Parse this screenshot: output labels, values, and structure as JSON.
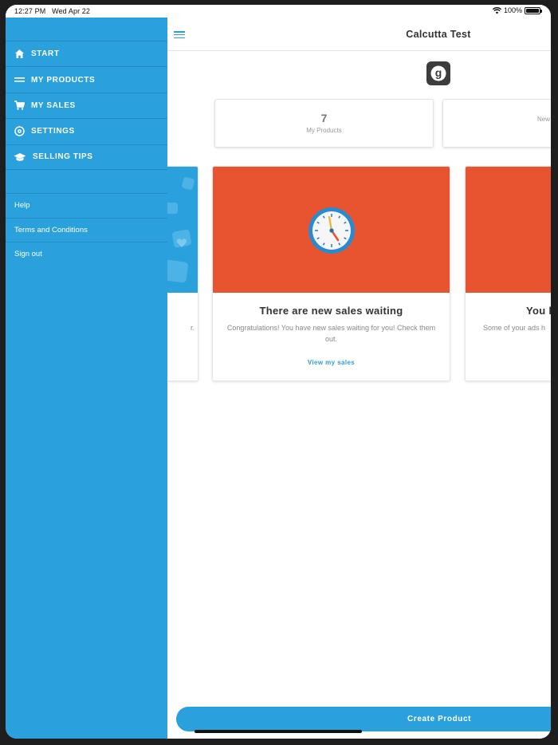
{
  "status_bar": {
    "time": "12:27 PM",
    "date": "Wed Apr 22",
    "battery": "100%"
  },
  "sidebar": {
    "nav_items": [
      {
        "label": "START",
        "icon": "home-icon"
      },
      {
        "label": "MY PRODUCTS",
        "icon": "list-icon"
      },
      {
        "label": "MY SALES",
        "icon": "cart-icon"
      },
      {
        "label": "SETTINGS",
        "icon": "settings-icon"
      },
      {
        "label": "SELLING TIPS",
        "icon": "graduation-cap-icon"
      }
    ],
    "secondary_items": [
      {
        "label": "Help"
      },
      {
        "label": "Terms and Conditions"
      },
      {
        "label": "Sign out"
      }
    ]
  },
  "header": {
    "title": "Calcutta Test",
    "menu_icon": "hamburger-icon"
  },
  "logo": {
    "letter": "g"
  },
  "stats": [
    {
      "value": "7",
      "label": "My Products"
    },
    {
      "value": "",
      "label": "New"
    }
  ],
  "cards": [
    {
      "title": "",
      "text": "r.",
      "link": ""
    },
    {
      "title": "There are new sales waiting",
      "text": "Congratulations! You have new sales waiting for you! Check them out.",
      "link": "View my sales",
      "icon": "clock-icon"
    },
    {
      "title": "You h",
      "text": "Some of your ads h",
      "link": ""
    }
  ],
  "footer": {
    "create_label": "Create Product"
  },
  "colors": {
    "primary": "#2aa0dc",
    "hero_orange": "#e8542f"
  }
}
